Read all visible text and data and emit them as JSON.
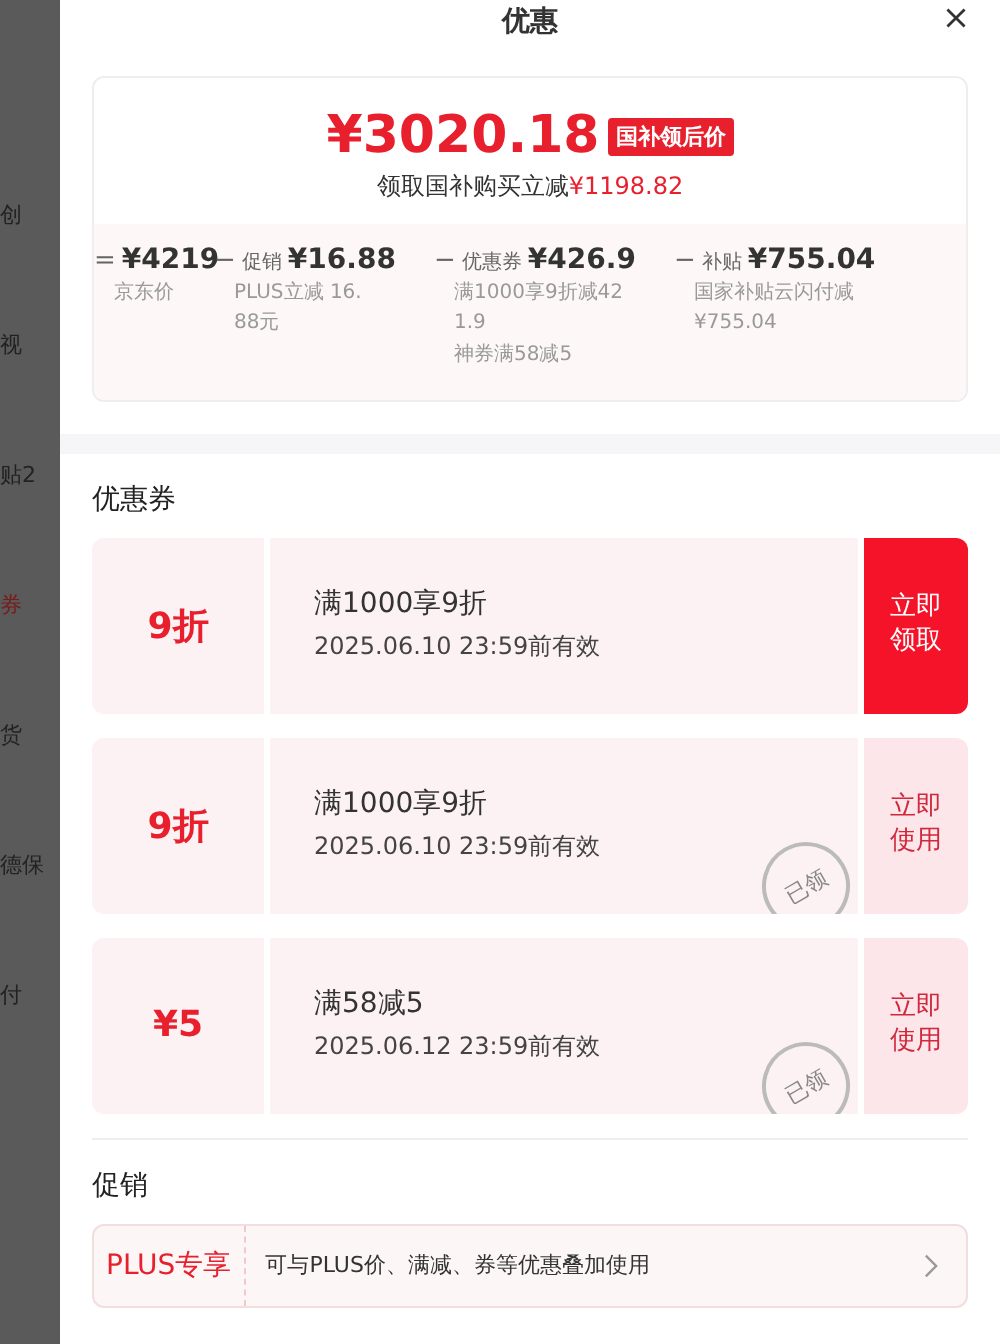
{
  "background_page": {
    "fragments": [
      "创",
      "视",
      "贴2",
      "券",
      "货",
      "德保",
      "付"
    ]
  },
  "sheet": {
    "title": "优惠"
  },
  "price_summary": {
    "final_price": "¥3020.18",
    "badge": "国补领后价",
    "saving_label": "领取国补购买立减",
    "saving_amount": "¥1198.82",
    "breakdown": [
      {
        "operator": "=",
        "amount": "¥4219",
        "notes": [
          "京东价"
        ]
      },
      {
        "operator": "−",
        "label": "促销",
        "amount": "¥16.88",
        "notes": [
          "PLUS立减 16.88元"
        ]
      },
      {
        "operator": "−",
        "label": "优惠券",
        "amount": "¥426.9",
        "notes": [
          "满1000享9折减421.9",
          "神券满58减5"
        ]
      },
      {
        "operator": "−",
        "label": "补贴",
        "amount": "¥755.04",
        "notes": [
          "国家补贴云闪付减¥755.04"
        ]
      }
    ]
  },
  "coupons": {
    "title": "优惠券",
    "items": [
      {
        "value": "9折",
        "condition": "满1000享9折",
        "validity": "2025.06.10 23:59前有效",
        "action": "立即领取",
        "claimed": false
      },
      {
        "value": "9折",
        "condition": "满1000享9折",
        "validity": "2025.06.10 23:59前有效",
        "action": "立即使用",
        "claimed": true,
        "stamp": "已领"
      },
      {
        "value": "¥5",
        "condition": "满58减5",
        "validity": "2025.06.12 23:59前有效",
        "action": "立即使用",
        "claimed": true,
        "stamp": "已领"
      }
    ]
  },
  "promotions": {
    "title": "促销",
    "items": [
      {
        "tag": "PLUS专享",
        "text": "可与PLUS价、满减、券等优惠叠加使用"
      }
    ]
  }
}
